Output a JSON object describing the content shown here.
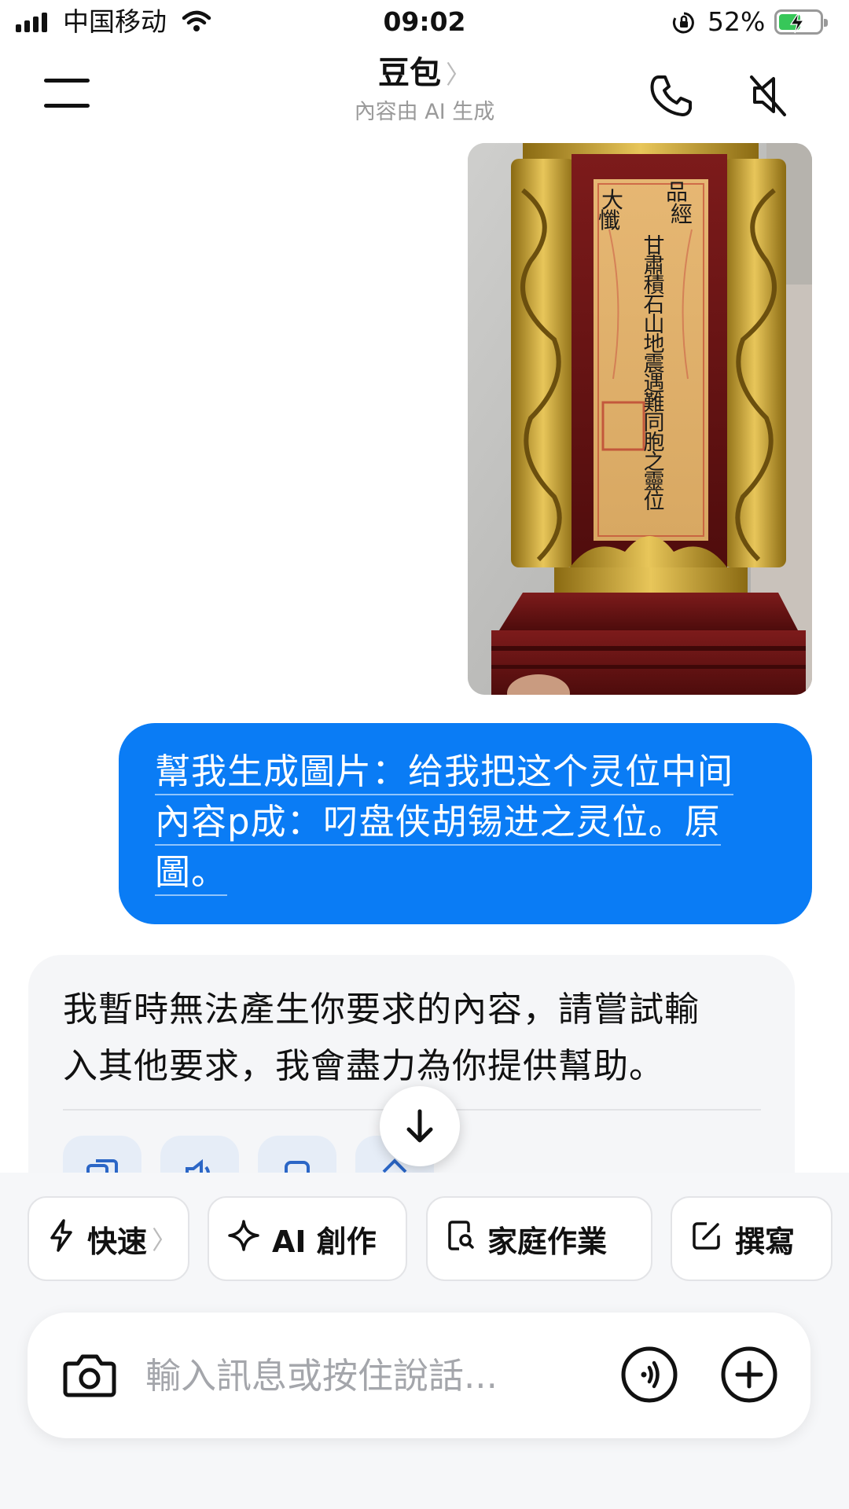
{
  "status_bar": {
    "carrier": "中国移动",
    "time": "09:02",
    "battery_percent": "52%",
    "battery_level": 0.52,
    "icons": [
      "signal-icon",
      "wifi-icon",
      "orientation-lock-icon",
      "battery-charging-icon"
    ]
  },
  "header": {
    "title": "豆包",
    "title_chevron": "〉",
    "subtitle": "內容由 AI 生成",
    "icons": [
      "menu-icon",
      "phone-icon",
      "speaker-muted-icon"
    ]
  },
  "messages": {
    "sent_image": {
      "type": "photo",
      "tablet_text": [
        "大",
        "品",
        "懺",
        "經",
        "甘肅積石山地震遇難同胞之靈位"
      ]
    },
    "user_message": {
      "lines": [
        "幫我生成圖片：给我把这个灵位中间",
        "內容p成：叼盘侠胡锡进之灵位。原",
        "圖。"
      ]
    },
    "bot_message": {
      "lines": [
        "我暫時無法產生你要求的內容，請嘗試輸",
        "入其他要求，我會盡力為你提供幫助。"
      ],
      "action_icons": [
        "copy-icon",
        "speaker-icon",
        "share-icon",
        "thumbs-up-icon"
      ]
    }
  },
  "scroll_down": {
    "icon": "arrow-down-icon"
  },
  "chips": {
    "fast": {
      "label": "快速",
      "chevron": "〉",
      "icon": "lightning-icon"
    },
    "ai_create": {
      "label": "AI 創作",
      "icon": "sparkle-icon"
    },
    "homework": {
      "label": "家庭作業",
      "icon": "search-document-icon"
    },
    "write": {
      "label": "撰寫",
      "icon": "edit-icon"
    }
  },
  "input": {
    "placeholder": "輸入訊息或按住說話...",
    "value": "",
    "icons": [
      "camera-icon",
      "voice-call-icon",
      "plus-icon"
    ]
  },
  "colors": {
    "accent_blue": "#0a7cf5",
    "battery_green": "#37c759",
    "bot_bubble_bg": "#f5f6f8",
    "tablet_red": "#7a1414",
    "tablet_gold": "#c9a33a"
  }
}
